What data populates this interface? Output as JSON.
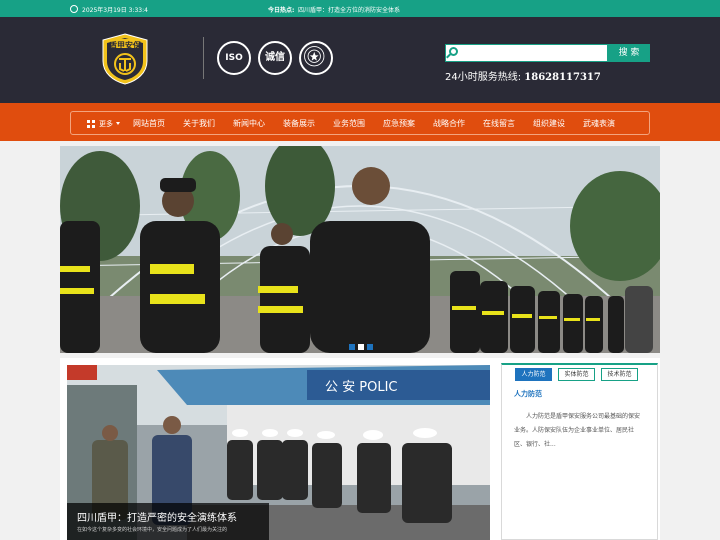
{
  "topbar": {
    "time": "2025年3月19日 3:33:4",
    "hot_label": "今日热点:",
    "hot_news": "四川盾甲：打造全方位的消防安全体系"
  },
  "header": {
    "logo_text": "盾甲安保",
    "cert_iso": "ISO",
    "cert_badge": "诚信",
    "cert_badge_caption": "诚信企业",
    "search_placeholder": "",
    "search_button": "搜 索",
    "hotline_label": "24小时服务热线:",
    "hotline_number": "18628117317"
  },
  "nav": {
    "more": "更多",
    "items": [
      "网站首页",
      "关于我们",
      "新闻中心",
      "装备展示",
      "业务范围",
      "应急预案",
      "战略合作",
      "在线留言",
      "组织建设",
      "武魂表演"
    ]
  },
  "banner": {
    "slide_count": 3,
    "active_slide": 2
  },
  "news": {
    "photo_sign": "公 安 POLIC",
    "title": "四川盾甲：打造严密的安全演练体系",
    "summary": "在如今这个复杂多变的社会环境中，安全问题成为了人们最为关注的"
  },
  "side": {
    "tabs": [
      "人力防范",
      "实体防范",
      "技术防范"
    ],
    "active_tab": 0,
    "title": "人力防范",
    "text": "人力防范是盾甲保安服务公司最基础的保安业务。人防保安队伍为企业事业单位、居民社区、银行、社..."
  },
  "colors": {
    "teal": "#17a186",
    "orange": "#e04d0e",
    "dark": "#2a2a36",
    "blue": "#1e73be"
  }
}
